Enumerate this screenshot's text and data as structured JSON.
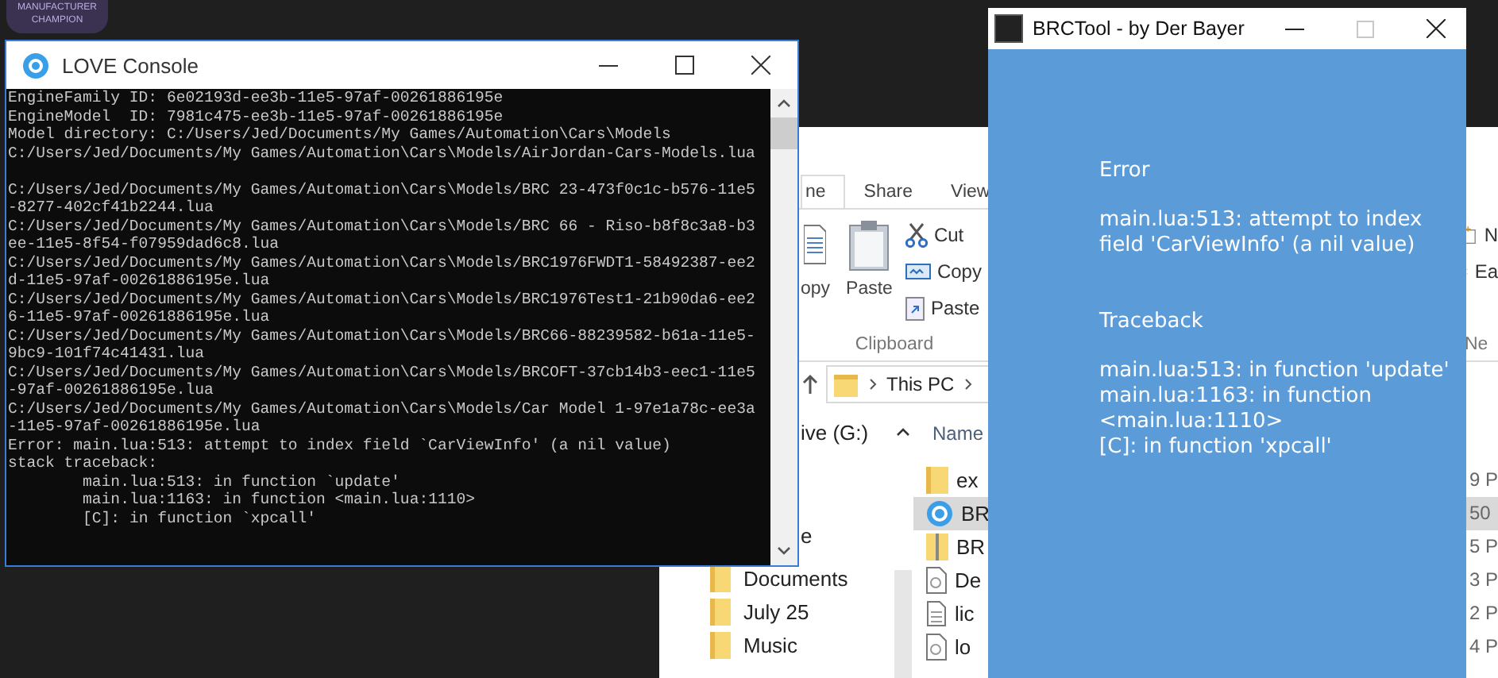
{
  "desktop": {
    "badge_lines": [
      "MANUFACTURER",
      "CHAMPION"
    ]
  },
  "explorer": {
    "tabs": [
      {
        "label": "ne",
        "selected": true
      },
      {
        "label": "Share",
        "selected": false
      },
      {
        "label": "View",
        "selected": false
      }
    ],
    "clipboard": {
      "copy_label": "opy",
      "paste_label": "Paste",
      "small_buttons": [
        {
          "kind": "cut",
          "label": "Cut"
        },
        {
          "kind": "copy",
          "label": "Copy"
        },
        {
          "kind": "paste-shortcut",
          "label": "Paste"
        }
      ],
      "group_label": "Clipboard"
    },
    "new_group": {
      "buttons": [
        {
          "kind": "new-item",
          "label": "N"
        },
        {
          "kind": "easy-access",
          "label": "Ea"
        }
      ],
      "group_label": "Ne"
    },
    "address": {
      "segments": [
        "This PC"
      ]
    },
    "nav_items": [
      {
        "kind": "partial",
        "label": "ive (G:)"
      },
      {
        "kind": "partial",
        "label": "e"
      },
      {
        "kind": "folder",
        "label": "Documents"
      },
      {
        "kind": "folder",
        "label": "July 25"
      },
      {
        "kind": "folder",
        "label": "Music"
      }
    ],
    "columns": [
      "Name"
    ],
    "files": [
      {
        "kind": "folder",
        "name": "ex",
        "time": "9 P",
        "selected": false
      },
      {
        "kind": "app",
        "name": "BR",
        "time": "50",
        "selected": true
      },
      {
        "kind": "zip",
        "name": "BR",
        "time": "5 P",
        "selected": false
      },
      {
        "kind": "document",
        "name": "De",
        "time": "3 P",
        "selected": false
      },
      {
        "kind": "text",
        "name": "lic",
        "time": "2 P",
        "selected": false
      },
      {
        "kind": "document",
        "name": "lo",
        "time": "4 P",
        "selected": false
      }
    ]
  },
  "console": {
    "title": "LOVE Console",
    "lines": [
      "EngineFamily ID: 6e02193d-ee3b-11e5-97af-00261886195e",
      "EngineModel  ID: 7981c475-ee3b-11e5-97af-00261886195e",
      "Model directory: C:/Users/Jed/Documents/My Games/Automation\\Cars\\Models",
      "C:/Users/Jed/Documents/My Games/Automation\\Cars\\Models/AirJordan-Cars-Models.lua",
      "C:/Users/Jed/Documents/My Games/Automation\\Cars\\Models/BRC 23-473f0c1c-b576-11e5",
      "-8277-402cf41b2244.lua",
      "C:/Users/Jed/Documents/My Games/Automation\\Cars\\Models/BRC 66 - Riso-b8f8c3a8-b3",
      "ee-11e5-8f54-f07959dad6c8.lua",
      "C:/Users/Jed/Documents/My Games/Automation\\Cars\\Models/BRC1976FWDT1-58492387-ee2",
      "d-11e5-97af-00261886195e.lua",
      "C:/Users/Jed/Documents/My Games/Automation\\Cars\\Models/BRC1976Test1-21b90da6-ee2",
      "6-11e5-97af-00261886195e.lua",
      "C:/Users/Jed/Documents/My Games/Automation\\Cars\\Models/BRC66-88239582-b61a-11e5-",
      "9bc9-101f74c41431.lua",
      "C:/Users/Jed/Documents/My Games/Automation\\Cars\\Models/BRCOFT-37cb14b3-eec1-11e5",
      "-97af-00261886195e.lua",
      "C:/Users/Jed/Documents/My Games/Automation\\Cars\\Models/Car Model 1-97e1a78c-ee3a",
      "-11e5-97af-00261886195e.lua",
      "Error: main.lua:513: attempt to index field `CarViewInfo' (a nil value)",
      "stack traceback:",
      "\tmain.lua:513: in function `update'",
      "\tmain.lua:1163: in function <main.lua:1110>",
      "\t[C]: in function `xpcall'"
    ]
  },
  "brctool": {
    "title": "BRCTool - by Der Bayer",
    "maximize_disabled": true,
    "error_heading": "Error",
    "message_lines": [
      "main.lua:513: attempt to index",
      "field 'CarViewInfo' (a nil value)"
    ],
    "traceback_heading": "Traceback",
    "traceback_lines": [
      "main.lua:513: in function 'update'",
      "main.lua:1163: in function",
      "<main.lua:1110>",
      "[C]: in function 'xpcall'"
    ]
  }
}
